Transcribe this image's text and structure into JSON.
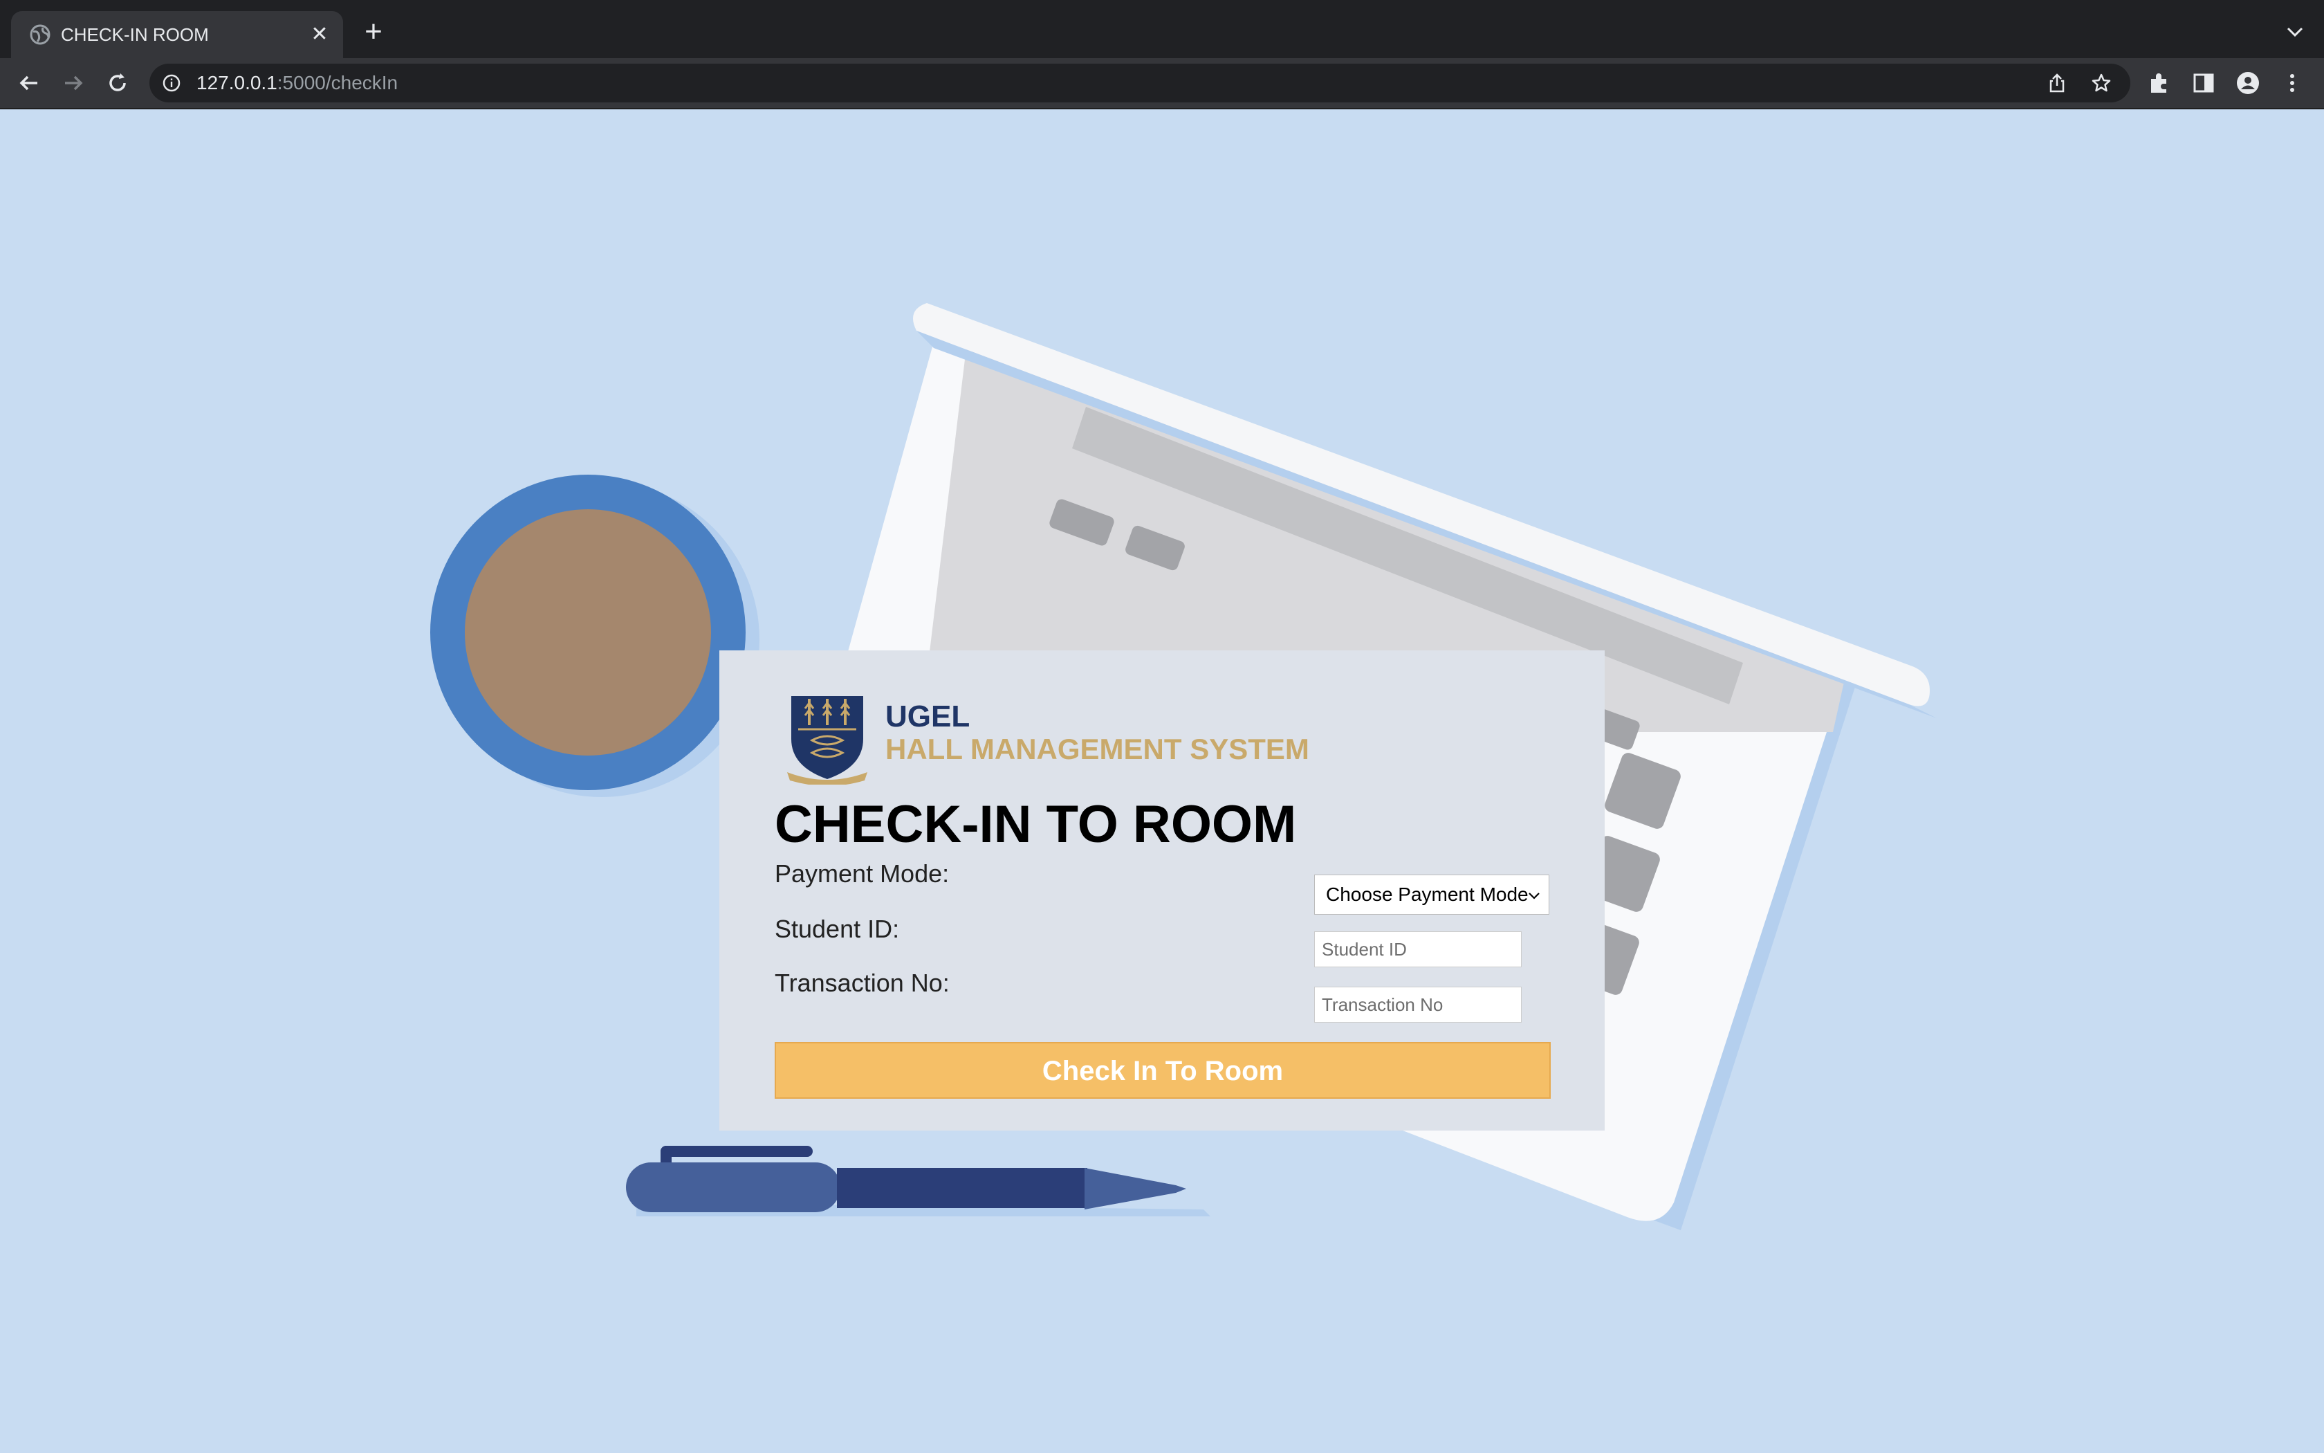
{
  "browser": {
    "tab_title": "CHECK-IN ROOM",
    "url_host": "127.0.0.1",
    "url_path": ":5000/checkIn"
  },
  "brand": {
    "name": "UGEL",
    "system": "HALL MANAGEMENT SYSTEM",
    "crest_motto": "INTEGRI PROCEDAMUS"
  },
  "form": {
    "title": "CHECK-IN TO ROOM",
    "payment_label": "Payment Mode:",
    "payment_selected": "Choose Payment Mode",
    "student_label": "Student ID:",
    "student_placeholder": "Student ID",
    "transaction_label": "Transaction No:",
    "transaction_placeholder": "Transaction No",
    "submit_label": "Check In To Room"
  },
  "colors": {
    "background": "#c8dcf2",
    "card": "#dde2ea",
    "brand_navy": "#1f3566",
    "brand_gold": "#c9a96a",
    "button": "#f5bf67"
  }
}
